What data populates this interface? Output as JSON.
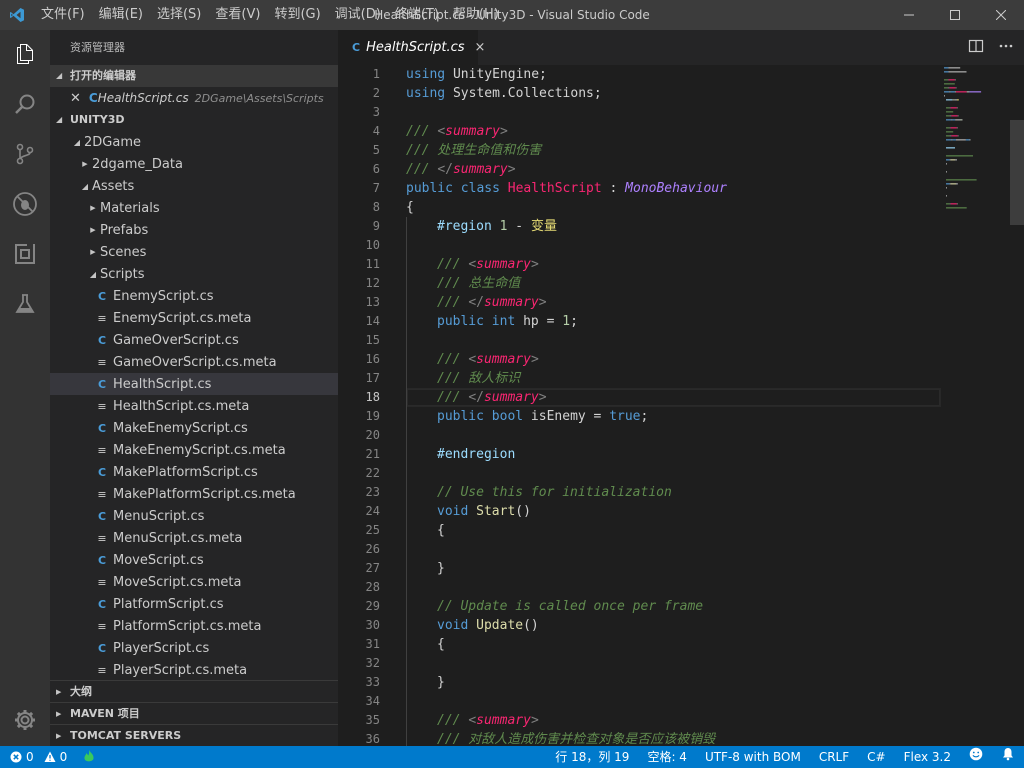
{
  "window": {
    "title": "HealthScript.cs - Unity3D - Visual Studio Code",
    "menu": [
      "文件(F)",
      "编辑(E)",
      "选择(S)",
      "查看(V)",
      "转到(G)",
      "调试(D)",
      "终端(T)",
      "帮助(H)"
    ]
  },
  "activity_bar": {
    "icons": [
      "explorer-icon",
      "search-icon",
      "source-control-icon",
      "debug-icon",
      "extensions-icon",
      "test-flask-icon"
    ],
    "bottom_icon": "gear-icon"
  },
  "sidebar": {
    "title": "资源管理器",
    "open_editors": {
      "header": "打开的编辑器",
      "items": [
        {
          "name": "HealthScript.cs",
          "path": "2DGame\\Assets\\Scripts"
        }
      ]
    },
    "workspace": {
      "header": "UNITY3D",
      "tree": [
        {
          "label": "2DGame",
          "depth": 0,
          "expanded": true,
          "kind": "folder"
        },
        {
          "label": "2dgame_Data",
          "depth": 1,
          "expanded": false,
          "kind": "folder"
        },
        {
          "label": "Assets",
          "depth": 1,
          "expanded": true,
          "kind": "folder"
        },
        {
          "label": "Materials",
          "depth": 2,
          "expanded": false,
          "kind": "folder"
        },
        {
          "label": "Prefabs",
          "depth": 2,
          "expanded": false,
          "kind": "folder"
        },
        {
          "label": "Scenes",
          "depth": 2,
          "expanded": false,
          "kind": "folder"
        },
        {
          "label": "Scripts",
          "depth": 2,
          "expanded": true,
          "kind": "folder"
        },
        {
          "label": "EnemyScript.cs",
          "depth": 3,
          "kind": "cs"
        },
        {
          "label": "EnemyScript.cs.meta",
          "depth": 3,
          "kind": "meta"
        },
        {
          "label": "GameOverScript.cs",
          "depth": 3,
          "kind": "cs"
        },
        {
          "label": "GameOverScript.cs.meta",
          "depth": 3,
          "kind": "meta"
        },
        {
          "label": "HealthScript.cs",
          "depth": 3,
          "kind": "cs",
          "selected": true
        },
        {
          "label": "HealthScript.cs.meta",
          "depth": 3,
          "kind": "meta"
        },
        {
          "label": "MakeEnemyScript.cs",
          "depth": 3,
          "kind": "cs"
        },
        {
          "label": "MakeEnemyScript.cs.meta",
          "depth": 3,
          "kind": "meta"
        },
        {
          "label": "MakePlatformScript.cs",
          "depth": 3,
          "kind": "cs"
        },
        {
          "label": "MakePlatformScript.cs.meta",
          "depth": 3,
          "kind": "meta"
        },
        {
          "label": "MenuScript.cs",
          "depth": 3,
          "kind": "cs"
        },
        {
          "label": "MenuScript.cs.meta",
          "depth": 3,
          "kind": "meta"
        },
        {
          "label": "MoveScript.cs",
          "depth": 3,
          "kind": "cs"
        },
        {
          "label": "MoveScript.cs.meta",
          "depth": 3,
          "kind": "meta"
        },
        {
          "label": "PlatformScript.cs",
          "depth": 3,
          "kind": "cs"
        },
        {
          "label": "PlatformScript.cs.meta",
          "depth": 3,
          "kind": "meta"
        },
        {
          "label": "PlayerScript.cs",
          "depth": 3,
          "kind": "cs"
        },
        {
          "label": "PlayerScript.cs.meta",
          "depth": 3,
          "kind": "meta"
        }
      ]
    },
    "bottom_sections": [
      "大纲",
      "MAVEN 项目",
      "TOMCAT SERVERS"
    ]
  },
  "editor": {
    "tab": {
      "label": "HealthScript.cs",
      "close": "×"
    },
    "active_line": 18,
    "lines": [
      {
        "n": 1,
        "indent": 0,
        "tokens": [
          [
            "k",
            "using"
          ],
          [
            "t",
            " UnityEngine;"
          ]
        ]
      },
      {
        "n": 2,
        "indent": 0,
        "tokens": [
          [
            "k",
            "using"
          ],
          [
            "t",
            " System.Collections;"
          ]
        ]
      },
      {
        "n": 3,
        "indent": 0,
        "tokens": []
      },
      {
        "n": 4,
        "indent": 0,
        "tokens": [
          [
            "cm",
            "/// "
          ],
          [
            "ptag",
            "<"
          ],
          [
            "tg",
            "summary"
          ],
          [
            "ptag",
            ">"
          ]
        ]
      },
      {
        "n": 5,
        "indent": 0,
        "tokens": [
          [
            "cm",
            "/// 处理生命值和伤害"
          ]
        ]
      },
      {
        "n": 6,
        "indent": 0,
        "tokens": [
          [
            "cm",
            "/// "
          ],
          [
            "ptag",
            "</"
          ],
          [
            "tg",
            "summary"
          ],
          [
            "ptag",
            ">"
          ]
        ]
      },
      {
        "n": 7,
        "indent": 0,
        "tokens": [
          [
            "k",
            "public"
          ],
          [
            "t",
            " "
          ],
          [
            "k",
            "class"
          ],
          [
            "t",
            " "
          ],
          [
            "cls",
            "HealthScript"
          ],
          [
            "t",
            " : "
          ],
          [
            "base",
            "MonoBehaviour"
          ]
        ]
      },
      {
        "n": 8,
        "indent": 0,
        "tokens": [
          [
            "t",
            "{"
          ]
        ]
      },
      {
        "n": 9,
        "indent": 1,
        "tokens": [
          [
            "region",
            "#region"
          ],
          [
            "t",
            " "
          ],
          [
            "num",
            "1"
          ],
          [
            "t",
            " - "
          ],
          [
            "region-cn",
            "变量"
          ]
        ]
      },
      {
        "n": 10,
        "indent": 1,
        "tokens": []
      },
      {
        "n": 11,
        "indent": 1,
        "tokens": [
          [
            "cm",
            "/// "
          ],
          [
            "ptag",
            "<"
          ],
          [
            "tg",
            "summary"
          ],
          [
            "ptag",
            ">"
          ]
        ]
      },
      {
        "n": 12,
        "indent": 1,
        "tokens": [
          [
            "cm",
            "/// 总生命值"
          ]
        ]
      },
      {
        "n": 13,
        "indent": 1,
        "tokens": [
          [
            "cm",
            "/// "
          ],
          [
            "ptag",
            "</"
          ],
          [
            "tg",
            "summary"
          ],
          [
            "ptag",
            ">"
          ]
        ]
      },
      {
        "n": 14,
        "indent": 1,
        "tokens": [
          [
            "k",
            "public"
          ],
          [
            "t",
            " "
          ],
          [
            "k",
            "int"
          ],
          [
            "t",
            " hp = "
          ],
          [
            "num",
            "1"
          ],
          [
            "t",
            ";"
          ]
        ]
      },
      {
        "n": 15,
        "indent": 1,
        "tokens": []
      },
      {
        "n": 16,
        "indent": 1,
        "tokens": [
          [
            "cm",
            "/// "
          ],
          [
            "ptag",
            "<"
          ],
          [
            "tg",
            "summary"
          ],
          [
            "ptag",
            ">"
          ]
        ]
      },
      {
        "n": 17,
        "indent": 1,
        "tokens": [
          [
            "cm",
            "/// 敌人标识"
          ]
        ]
      },
      {
        "n": 18,
        "indent": 1,
        "tokens": [
          [
            "cm",
            "/// "
          ],
          [
            "ptag",
            "</"
          ],
          [
            "tg",
            "summary"
          ],
          [
            "ptag",
            ">"
          ]
        ]
      },
      {
        "n": 19,
        "indent": 1,
        "tokens": [
          [
            "k",
            "public"
          ],
          [
            "t",
            " "
          ],
          [
            "k",
            "bool"
          ],
          [
            "t",
            " isEnemy = "
          ],
          [
            "k",
            "true"
          ],
          [
            "t",
            ";"
          ]
        ]
      },
      {
        "n": 20,
        "indent": 1,
        "tokens": []
      },
      {
        "n": 21,
        "indent": 1,
        "tokens": [
          [
            "region",
            "#endregion"
          ]
        ]
      },
      {
        "n": 22,
        "indent": 1,
        "tokens": []
      },
      {
        "n": 23,
        "indent": 1,
        "tokens": [
          [
            "cm",
            "// Use this for initialization"
          ]
        ]
      },
      {
        "n": 24,
        "indent": 1,
        "tokens": [
          [
            "k",
            "void"
          ],
          [
            "t",
            " "
          ],
          [
            "fn",
            "Start"
          ],
          [
            "t",
            "()"
          ]
        ]
      },
      {
        "n": 25,
        "indent": 1,
        "tokens": [
          [
            "t",
            "{"
          ]
        ]
      },
      {
        "n": 26,
        "indent": 1,
        "tokens": []
      },
      {
        "n": 27,
        "indent": 1,
        "tokens": [
          [
            "t",
            "}"
          ]
        ]
      },
      {
        "n": 28,
        "indent": 1,
        "tokens": []
      },
      {
        "n": 29,
        "indent": 1,
        "tokens": [
          [
            "cm",
            "// Update is called once per frame"
          ]
        ]
      },
      {
        "n": 30,
        "indent": 1,
        "tokens": [
          [
            "k",
            "void"
          ],
          [
            "t",
            " "
          ],
          [
            "fn",
            "Update"
          ],
          [
            "t",
            "()"
          ]
        ]
      },
      {
        "n": 31,
        "indent": 1,
        "tokens": [
          [
            "t",
            "{"
          ]
        ]
      },
      {
        "n": 32,
        "indent": 1,
        "tokens": []
      },
      {
        "n": 33,
        "indent": 1,
        "tokens": [
          [
            "t",
            "}"
          ]
        ]
      },
      {
        "n": 34,
        "indent": 1,
        "tokens": []
      },
      {
        "n": 35,
        "indent": 1,
        "tokens": [
          [
            "cm",
            "/// "
          ],
          [
            "ptag",
            "<"
          ],
          [
            "tg",
            "summary"
          ],
          [
            "ptag",
            ">"
          ]
        ]
      },
      {
        "n": 36,
        "indent": 1,
        "tokens": [
          [
            "cm",
            "/// 对敌人造成伤害并检查对象是否应该被销毁"
          ]
        ]
      }
    ]
  },
  "status_bar": {
    "errors": "0",
    "warnings": "0",
    "position": "行 18，列 19",
    "spaces": "空格: 4",
    "encoding": "UTF-8 with BOM",
    "eol": "CRLF",
    "language": "C#",
    "flex": "Flex 3.2"
  },
  "colors": {
    "accent": "#007acc",
    "titlebar": "#3c3c3c",
    "sidebar": "#252526",
    "editor_bg": "#1e1e1e",
    "keyword": "#569cd6",
    "comment": "#608b4e",
    "tag": "#f92672"
  }
}
